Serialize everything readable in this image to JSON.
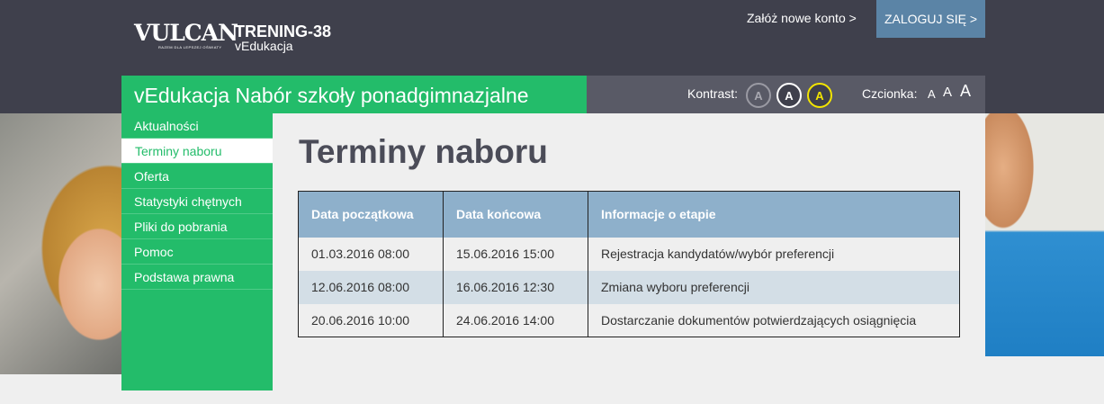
{
  "brand": {
    "logo": "VULCAN",
    "logo_tagline": "Razem dla lepszej oświaty",
    "site_title": "TRENING-38",
    "site_subtitle": "vEdukacja"
  },
  "auth": {
    "register_label": "Załóż nowe konto >",
    "login_label": "ZALOGUJ SIĘ >"
  },
  "header_bar": {
    "title": "vEdukacja Nabór szkoły ponadgimnazjalne",
    "contrast_label": "Kontrast:",
    "contrast_options": [
      "A",
      "A",
      "A"
    ],
    "font_label": "Czcionka:",
    "font_options": [
      "A",
      "A",
      "A"
    ]
  },
  "sidebar": {
    "items": [
      {
        "label": "Aktualności"
      },
      {
        "label": "Terminy naboru",
        "active": true
      },
      {
        "label": "Oferta"
      },
      {
        "label": "Statystyki chętnych"
      },
      {
        "label": "Pliki do pobrania"
      },
      {
        "label": "Pomoc"
      },
      {
        "label": "Podstawa prawna"
      }
    ]
  },
  "main": {
    "title": "Terminy naboru",
    "table": {
      "headers": [
        "Data początkowa",
        "Data końcowa",
        "Informacje o etapie"
      ],
      "rows": [
        [
          "01.03.2016 08:00",
          "15.06.2016 15:00",
          "Rejestracja kandydatów/wybór preferencji"
        ],
        [
          "12.06.2016 08:00",
          "16.06.2016 12:30",
          "Zmiana wyboru preferencji"
        ],
        [
          "20.06.2016 10:00",
          "24.06.2016 14:00",
          "Dostarczanie dokumentów potwierdzających osiągnięcia"
        ]
      ]
    }
  },
  "colors": {
    "green": "#23bc6a",
    "dark": "#3f404c",
    "login_blue": "#5b84a6",
    "table_header": "#8eb0cb",
    "stripe": "#d3dee6"
  }
}
